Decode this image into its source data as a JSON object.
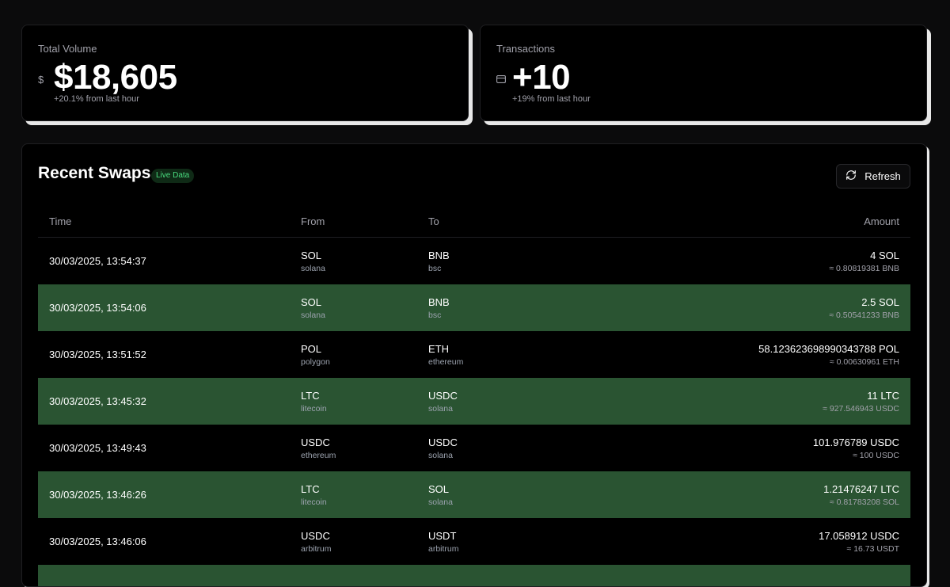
{
  "stats": {
    "volume": {
      "label": "Total Volume",
      "icon": "dollar-icon",
      "value": "$18,605",
      "change": "+20.1% from last hour"
    },
    "transactions": {
      "label": "Transactions",
      "icon": "credit-card-icon",
      "value": "+10",
      "change": "+19% from last hour"
    }
  },
  "swaps": {
    "title": "Recent Swaps",
    "badge": "Live Data",
    "refresh_label": "Refresh",
    "columns": {
      "time": "Time",
      "from": "From",
      "to": "To",
      "amount": "Amount"
    },
    "rows": [
      {
        "time": "30/03/2025, 13:54:37",
        "from_symbol": "SOL",
        "from_chain": "solana",
        "to_symbol": "BNB",
        "to_chain": "bsc",
        "amount": "4 SOL",
        "approx": "≈ 0.80819381 BNB"
      },
      {
        "time": "30/03/2025, 13:54:06",
        "from_symbol": "SOL",
        "from_chain": "solana",
        "to_symbol": "BNB",
        "to_chain": "bsc",
        "amount": "2.5 SOL",
        "approx": "≈ 0.50541233 BNB"
      },
      {
        "time": "30/03/2025, 13:51:52",
        "from_symbol": "POL",
        "from_chain": "polygon",
        "to_symbol": "ETH",
        "to_chain": "ethereum",
        "amount": "58.123623698990343788 POL",
        "approx": "≈ 0.00630961 ETH"
      },
      {
        "time": "30/03/2025, 13:45:32",
        "from_symbol": "LTC",
        "from_chain": "litecoin",
        "to_symbol": "USDC",
        "to_chain": "solana",
        "amount": "11 LTC",
        "approx": "≈ 927.546943 USDC"
      },
      {
        "time": "30/03/2025, 13:49:43",
        "from_symbol": "USDC",
        "from_chain": "ethereum",
        "to_symbol": "USDC",
        "to_chain": "solana",
        "amount": "101.976789 USDC",
        "approx": "≈ 100 USDC"
      },
      {
        "time": "30/03/2025, 13:46:26",
        "from_symbol": "LTC",
        "from_chain": "litecoin",
        "to_symbol": "SOL",
        "to_chain": "solana",
        "amount": "1.21476247 LTC",
        "approx": "≈ 0.81783208 SOL"
      },
      {
        "time": "30/03/2025, 13:46:06",
        "from_symbol": "USDC",
        "from_chain": "arbitrum",
        "to_symbol": "USDT",
        "to_chain": "arbitrum",
        "amount": "17.058912 USDC",
        "approx": "≈ 16.73 USDT"
      }
    ]
  },
  "colors": {
    "highlight_row": "#2a5432",
    "badge_text": "#4ade80",
    "card_shadow": "#e8e8e8"
  }
}
